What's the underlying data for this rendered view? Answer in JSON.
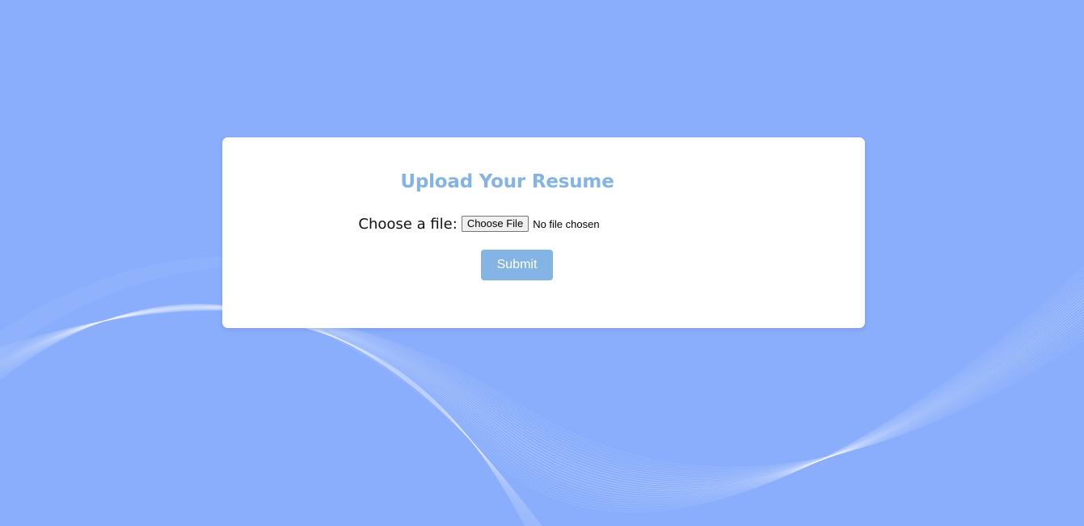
{
  "page": {
    "background_color": "#8aaefc"
  },
  "upload_card": {
    "title": "Upload Your Resume",
    "title_color": "#84b4e4",
    "file_label": "Choose a file:",
    "file_button_label": "Choose File",
    "file_status": "No file chosen",
    "submit_label": "Submit",
    "submit_color": "#84b4e4"
  }
}
